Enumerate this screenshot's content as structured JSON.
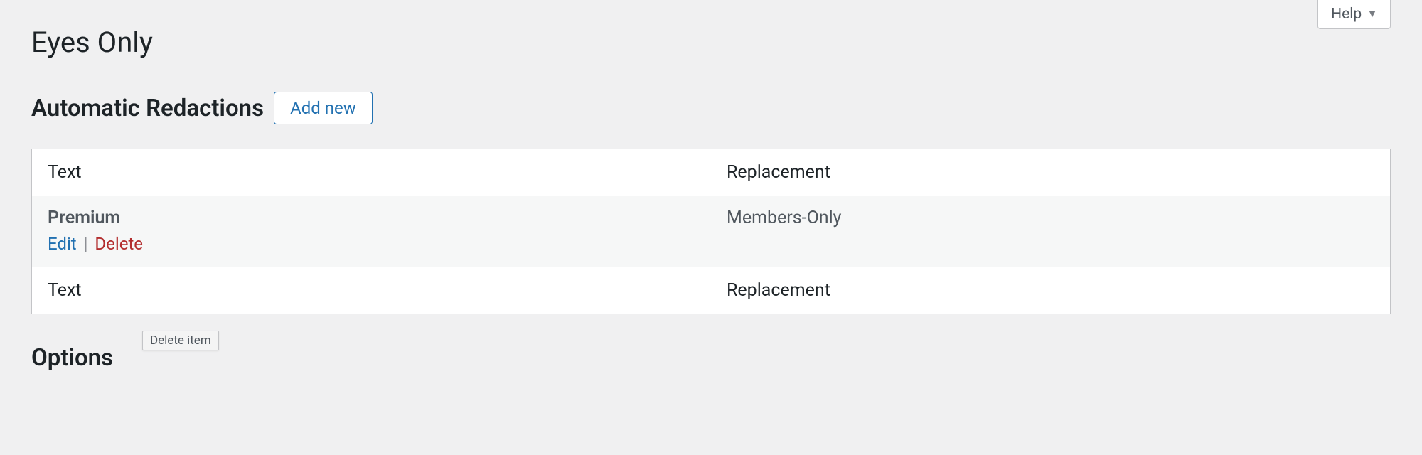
{
  "help": {
    "label": "Help"
  },
  "page": {
    "title": "Eyes Only"
  },
  "section": {
    "heading": "Automatic Redactions",
    "add_new": "Add new"
  },
  "table": {
    "columns": {
      "text": "Text",
      "replacement": "Replacement"
    },
    "rows": [
      {
        "text": "Premium",
        "replacement": "Members-Only",
        "actions": {
          "edit": "Edit",
          "delete": "Delete",
          "sep": "|"
        }
      }
    ]
  },
  "tooltip": {
    "delete": "Delete item"
  },
  "options": {
    "heading": "Options"
  }
}
